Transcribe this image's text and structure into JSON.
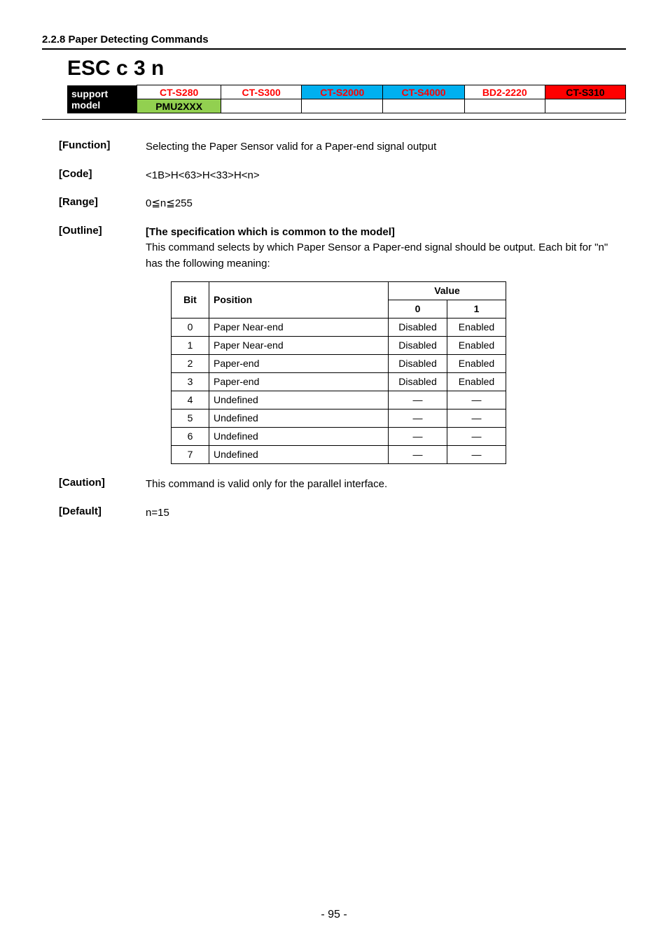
{
  "section_heading": "2.2.8 Paper Detecting Commands",
  "command_title": "ESC c 3 n",
  "support": {
    "label": "support model",
    "row1": [
      "CT-S280",
      "CT-S300",
      "CT-S2000",
      "CT-S4000",
      "BD2-2220",
      "CT-S310"
    ],
    "row2": [
      "PMU2XXX",
      "",
      "",
      "",
      "",
      ""
    ],
    "colors_row1": [
      "#ffffff",
      "#ffffff",
      "#00b0f0",
      "#00b0f0",
      "#ffffff",
      "#ff0000"
    ],
    "text_colors_row1": [
      "#ff0000",
      "#ff0000",
      "#ff0000",
      "#ff0000",
      "#ff0000",
      "#000000"
    ],
    "colors_row2": [
      "#92d050",
      "#ffffff",
      "#ffffff",
      "#ffffff",
      "#ffffff",
      "#ffffff"
    ],
    "text_colors_row2": [
      "#000000",
      "#000000",
      "#000000",
      "#000000",
      "#000000",
      "#000000"
    ]
  },
  "fields": {
    "function": {
      "label": "[Function]",
      "text": "Selecting the Paper Sensor valid for a Paper-end signal output"
    },
    "code": {
      "label": "[Code]",
      "text": "<1B>H<63>H<33>H<n>"
    },
    "range": {
      "label": "[Range]",
      "text": "0≦n≦255"
    },
    "outline": {
      "label": "[Outline]",
      "heading": "[The specification which is common to the model]",
      "text": "This command selects by which Paper Sensor a Paper-end signal should be output. Each bit for \"n\" has the following meaning:"
    },
    "caution": {
      "label": "[Caution]",
      "text": "This command is valid only for the parallel interface."
    },
    "default": {
      "label": "[Default]",
      "text": "n=15"
    }
  },
  "bit_table": {
    "headers": {
      "bit": "Bit",
      "position": "Position",
      "value": "Value",
      "v0": "0",
      "v1": "1"
    },
    "rows": [
      {
        "bit": "0",
        "pos": "Paper Near-end",
        "v0": "Disabled",
        "v1": "Enabled"
      },
      {
        "bit": "1",
        "pos": "Paper Near-end",
        "v0": "Disabled",
        "v1": "Enabled"
      },
      {
        "bit": "2",
        "pos": "Paper-end",
        "v0": "Disabled",
        "v1": "Enabled"
      },
      {
        "bit": "3",
        "pos": "Paper-end",
        "v0": "Disabled",
        "v1": "Enabled"
      },
      {
        "bit": "4",
        "pos": "Undefined",
        "v0": "―",
        "v1": "―"
      },
      {
        "bit": "5",
        "pos": "Undefined",
        "v0": "―",
        "v1": "―"
      },
      {
        "bit": "6",
        "pos": "Undefined",
        "v0": "―",
        "v1": "―"
      },
      {
        "bit": "7",
        "pos": "Undefined",
        "v0": "―",
        "v1": "―"
      }
    ]
  },
  "page_number": "- 95 -"
}
